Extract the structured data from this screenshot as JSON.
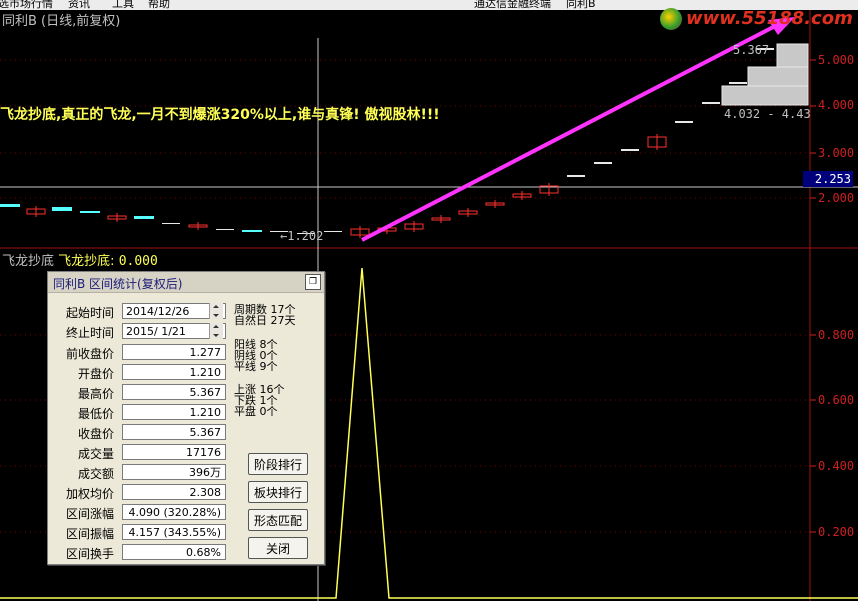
{
  "menubar": [
    "选市场行情",
    "资讯",
    "工具",
    "帮助",
    "通达信金融终端",
    "同利B"
  ],
  "chart": {
    "title": "同利B (日线,前复权)",
    "banner": "飞龙抄底,真正的飞龙,一月不到爆涨320%以上,谁与真锋! 傲视股林!!!",
    "price_axis_labels": [
      "5.000",
      "4.000",
      "3.000",
      "2.000"
    ],
    "current_price": "2.253",
    "low_label": "←1.202",
    "high_label": "5.367",
    "volume_labels": [
      "4.032 - 4.43"
    ],
    "watermark": "www.55188.com",
    "colors": {
      "up": "#ff3030",
      "down": "#55ffff",
      "arrow": "#ff33ff",
      "indicator": "#ffff55",
      "axis": "#cc2020"
    }
  },
  "indicator": {
    "name": "飞龙抄底",
    "label": "飞龙抄底:",
    "value": "0.000",
    "axis_labels": [
      "0.800",
      "0.600",
      "0.400",
      "0.200"
    ]
  },
  "dialog": {
    "title": "同利B 区间统计(复权后)",
    "restore_icon": "restore-icon",
    "start_label": "起始时间",
    "start_value": "2014/12/26",
    "end_label": "终止时间",
    "end_value": "2015/ 1/21",
    "rows": [
      {
        "label": "前收盘价",
        "value": "1.277"
      },
      {
        "label": "开盘价",
        "value": "1.210"
      },
      {
        "label": "最高价",
        "value": "5.367"
      },
      {
        "label": "最低价",
        "value": "1.210"
      },
      {
        "label": "收盘价",
        "value": "5.367"
      },
      {
        "label": "成交量",
        "value": "17176"
      },
      {
        "label": "成交额",
        "value": "396万"
      },
      {
        "label": "加权均价",
        "value": "2.308"
      },
      {
        "label": "区间涨幅",
        "value": "4.090 (320.28%)"
      },
      {
        "label": "区间振幅",
        "value": "4.157 (343.55%)"
      },
      {
        "label": "区间换手",
        "value": "0.68%"
      }
    ],
    "stats": {
      "periods": "周期数 17个",
      "natural_days": "自然日 27天",
      "yang": "阳线 8个",
      "yin": "阴线 0个",
      "flat_line": "平线 9个",
      "up": "上涨 16个",
      "down": "下跌 1个",
      "flat": "平盘 0个"
    },
    "buttons": {
      "stage_rank": "阶段排行",
      "sector_rank": "板块排行",
      "pattern_match": "形态匹配",
      "close": "关闭"
    }
  }
}
